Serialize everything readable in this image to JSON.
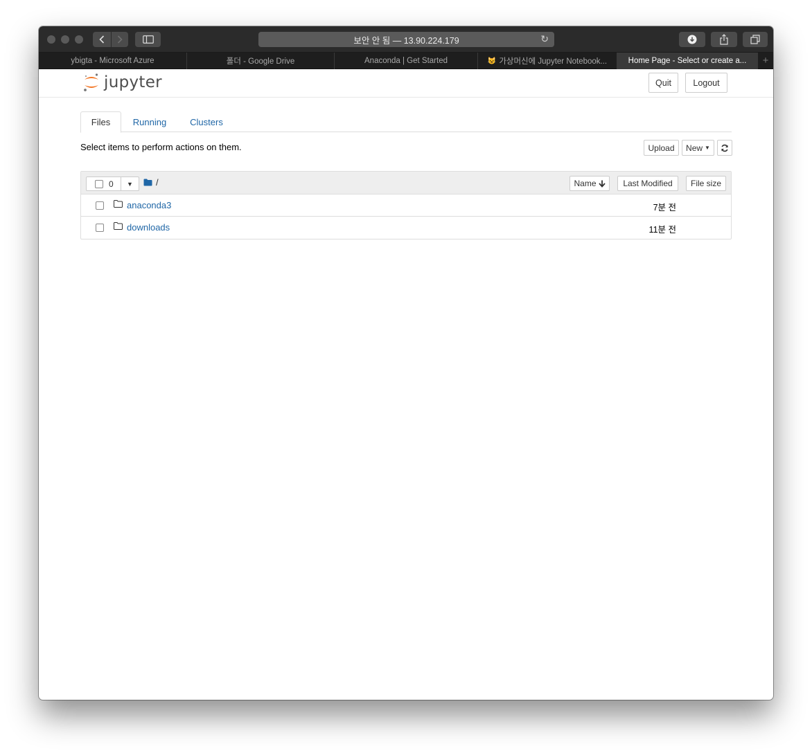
{
  "browser": {
    "address": "보안 안 됨 — 13.90.224.179",
    "tabs": [
      {
        "label": "ybigta - Microsoft Azure",
        "favicon": ""
      },
      {
        "label": "폴더 - Google Drive",
        "favicon": ""
      },
      {
        "label": "Anaconda | Get Started",
        "favicon": ""
      },
      {
        "label": "가상머신에 Jupyter Notebook...",
        "favicon": "😺"
      },
      {
        "label": "Home Page - Select or create a...",
        "favicon": ""
      }
    ],
    "new_tab": "+"
  },
  "header": {
    "logo_text": "jupyter",
    "quit_label": "Quit",
    "logout_label": "Logout"
  },
  "main": {
    "tabs": [
      {
        "label": "Files",
        "active": true
      },
      {
        "label": "Running",
        "active": false
      },
      {
        "label": "Clusters",
        "active": false
      }
    ],
    "hint": "Select items to perform actions on them.",
    "upload_label": "Upload",
    "new_label": "New",
    "selected_count": "0",
    "breadcrumb_path": "/",
    "sort": {
      "name_label": "Name",
      "modified_label": "Last Modified",
      "size_label": "File size"
    },
    "files": [
      {
        "name": "anaconda3",
        "modified": "7분 전"
      },
      {
        "name": "downloads",
        "modified": "11분 전"
      }
    ]
  },
  "colors": {
    "link": "#1f66a6",
    "logo_orange": "#f37726",
    "toolbar_bg": "#2b2b2b"
  }
}
